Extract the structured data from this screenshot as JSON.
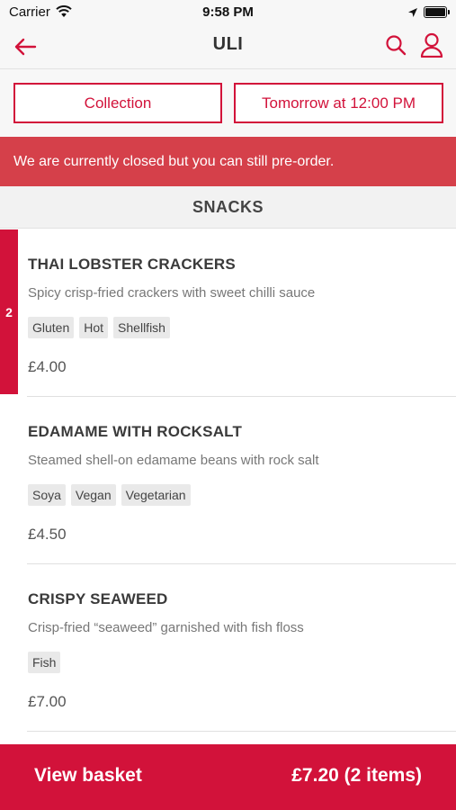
{
  "status_bar": {
    "carrier": "Carrier",
    "time": "9:58 PM"
  },
  "nav": {
    "title": "ULI",
    "icons": [
      "arrow-left-icon",
      "search-icon",
      "account-icon"
    ]
  },
  "options": {
    "collection_label": "Collection",
    "time_label": "Tomorrow at 12:00 PM"
  },
  "banner": {
    "text": "We are currently closed but you can still pre-order."
  },
  "section": {
    "title": "SNACKS"
  },
  "items": [
    {
      "name": "THAI LOBSTER CRACKERS",
      "description": "Spicy crisp-fried crackers with sweet chilli sauce",
      "tags": [
        "Gluten",
        "Hot",
        "Shellfish"
      ],
      "price": "£4.00",
      "quantity": "2"
    },
    {
      "name": "EDAMAME WITH ROCKSALT",
      "description": "Steamed shell-on edamame beans with rock salt",
      "tags": [
        "Soya",
        "Vegan",
        "Vegetarian"
      ],
      "price": "£4.50"
    },
    {
      "name": "CRISPY SEAWEED",
      "description": "Crisp-fried “seaweed” garnished with fish floss",
      "tags": [
        "Fish"
      ],
      "price": "£7.00"
    }
  ],
  "basket": {
    "label": "View basket",
    "total": "£7.20 (2 items)"
  },
  "colors": {
    "accent": "#d2123a",
    "banner": "#d5404a"
  }
}
